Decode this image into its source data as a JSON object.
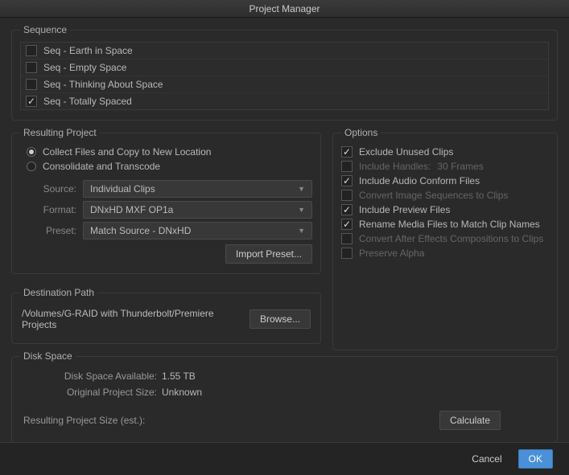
{
  "title": "Project Manager",
  "sequence": {
    "legend": "Sequence",
    "items": [
      {
        "label": "Seq - Earth in Space",
        "checked": false
      },
      {
        "label": "Seq - Empty Space",
        "checked": false
      },
      {
        "label": "Seq - Thinking About Space",
        "checked": false
      },
      {
        "label": "Seq - Totally Spaced",
        "checked": true
      }
    ]
  },
  "resulting": {
    "legend": "Resulting Project",
    "radio_collect": "Collect Files and Copy to New Location",
    "radio_transcode": "Consolidate and Transcode",
    "source_label": "Source:",
    "source_value": "Individual Clips",
    "format_label": "Format:",
    "format_value": "DNxHD MXF OP1a",
    "preset_label": "Preset:",
    "preset_value": "Match Source - DNxHD",
    "import_preset": "Import Preset..."
  },
  "options": {
    "legend": "Options",
    "exclude_unused": "Exclude Unused Clips",
    "include_handles": "Include Handles:",
    "handles_value": "30 Frames",
    "include_audio": "Include Audio Conform Files",
    "convert_image": "Convert Image Sequences to Clips",
    "include_preview": "Include Preview Files",
    "rename_media": "Rename Media Files to Match Clip Names",
    "convert_ae": "Convert After Effects Compositions to Clips",
    "preserve_alpha": "Preserve Alpha"
  },
  "destination": {
    "legend": "Destination Path",
    "path": "/Volumes/G-RAID with Thunderbolt/Premiere Projects",
    "browse": "Browse..."
  },
  "disk": {
    "legend": "Disk Space",
    "avail_label": "Disk Space Available:",
    "avail_value": "1.55 TB",
    "orig_label": "Original Project Size:",
    "orig_value": "Unknown",
    "result_label": "Resulting Project Size (est.):",
    "calculate": "Calculate"
  },
  "footer": {
    "cancel": "Cancel",
    "ok": "OK"
  }
}
